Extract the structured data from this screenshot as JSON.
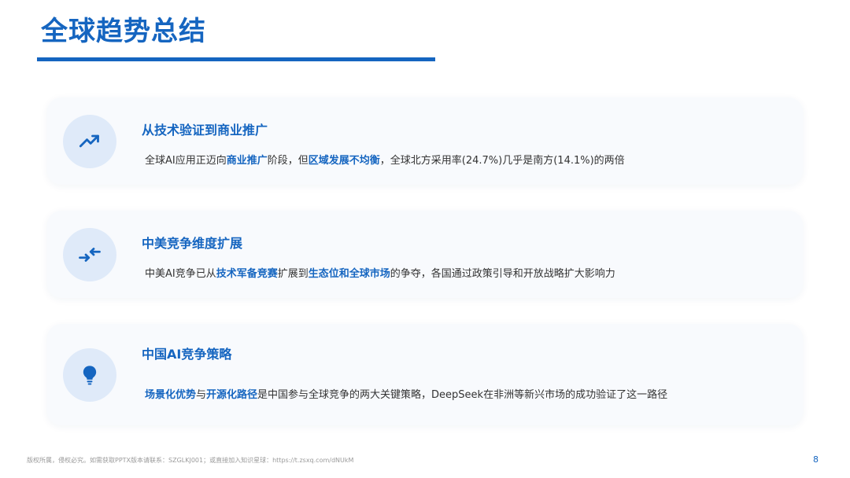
{
  "page": {
    "title": "全球趋势总结",
    "footer": "版权所属，侵权必究。如需获取PPTX版本请联系：SZGLKJ001；或直接加入知识星球：https://t.zsxq.com/dNUkM",
    "page_number": "8"
  },
  "colors": {
    "accent": "#1565c0",
    "card_background": "#f8fafd",
    "icon_circle": "#dfeaf9",
    "body_text": "#333333"
  },
  "cards": [
    {
      "icon": "trending-up-icon",
      "title": "从技术验证到商业推广",
      "desc": [
        "全球AI应用正迈向",
        "商业推广",
        "阶段，但",
        "区域发展不均衡",
        "，全球北方采用率(24.7%)几乎是南方(14.1%)的两倍"
      ]
    },
    {
      "icon": "compare-arrows-icon",
      "title": "中美竞争维度扩展",
      "desc": [
        "中美AI竞争已从",
        "技术军备竞赛",
        "扩展到",
        "生态位和全球市场",
        "的争夺，各国通过政策引导和开放战略扩大影响力"
      ]
    },
    {
      "icon": "lightbulb-icon",
      "title": "中国AI竞争策略",
      "desc": [
        "场景化优势",
        "与",
        "开源化路径",
        "是中国参与全球竞争的两大关键策略，DeepSeek在非洲等新兴市场的成功验证了这一路径"
      ]
    }
  ]
}
